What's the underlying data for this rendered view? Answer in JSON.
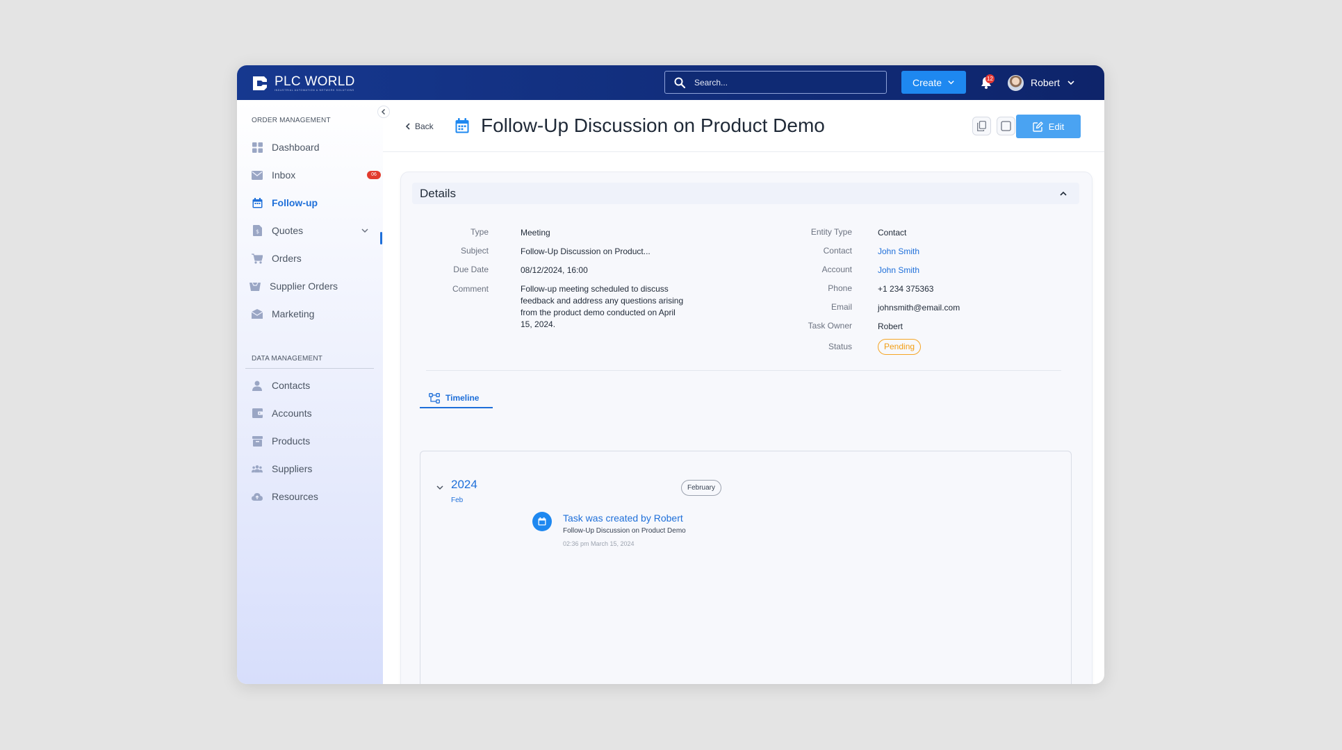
{
  "app": {
    "brand_name": "PLC WORLD",
    "brand_tagline": "INDUSTRIAL AUTOMATION & NETWORK SOLUTIONS",
    "search_placeholder": "Search...",
    "create_label": "Create",
    "notification_count": "12",
    "user_name": "Robert",
    "colors": {
      "topbar": "#16388f",
      "accent": "#1e88f0",
      "link": "#1e6fd9",
      "pending": "#f29d12",
      "badge": "#e23b2e"
    }
  },
  "sidebar": {
    "section_order": "ORDER MANAGEMENT",
    "section_data": "DATA MANAGEMENT",
    "order_items": [
      {
        "label": "Dashboard",
        "icon": "grid-icon"
      },
      {
        "label": "Inbox",
        "icon": "mail-icon",
        "badge": "06"
      },
      {
        "label": "Follow-up",
        "icon": "calendar-icon",
        "active": true
      },
      {
        "label": "Quotes",
        "icon": "quote-icon",
        "expandable": true
      },
      {
        "label": "Orders",
        "icon": "cart-icon"
      },
      {
        "label": "Supplier Orders",
        "icon": "supplier-orders-icon"
      },
      {
        "label": "Marketing",
        "icon": "marketing-icon"
      }
    ],
    "data_items": [
      {
        "label": "Contacts",
        "icon": "person-icon"
      },
      {
        "label": "Accounts",
        "icon": "wallet-icon"
      },
      {
        "label": "Products",
        "icon": "box-icon"
      },
      {
        "label": "Suppliers",
        "icon": "group-icon"
      },
      {
        "label": "Resources",
        "icon": "cloud-icon"
      }
    ]
  },
  "header": {
    "back_label": "Back",
    "title": "Follow-Up Discussion on Product Demo",
    "edit_label": "Edit"
  },
  "details": {
    "section_title": "Details",
    "left_fields": [
      {
        "label": "Type",
        "value": "Meeting"
      },
      {
        "label": "Subject",
        "value": "Follow-Up Discussion on Product..."
      },
      {
        "label": "Due Date",
        "value": "08/12/2024, 16:00"
      },
      {
        "label": "Comment",
        "value": "Follow-up meeting scheduled to discuss feedback and address any questions arising from the product demo conducted on April 15, 2024."
      }
    ],
    "right_fields": [
      {
        "label": "Entity Type",
        "value": "Contact"
      },
      {
        "label": "Contact",
        "value": "John Smith"
      },
      {
        "label": "Account",
        "value": "John Smith"
      },
      {
        "label": "Phone",
        "value": "+1 234 375363"
      },
      {
        "label": "Email",
        "value": "johnsmith@email.com"
      },
      {
        "label": "Task Owner",
        "value": "Robert"
      },
      {
        "label": "Status",
        "value": "Pending"
      }
    ]
  },
  "timeline": {
    "tab_label": "Timeline",
    "year": "2024",
    "month_short": "Feb",
    "month_pill": "February",
    "events": [
      {
        "title": "Task was created by Robert",
        "subtitle": "Follow-Up Discussion on Product Demo",
        "timestamp": "02:36 pm March 15, 2024"
      }
    ]
  }
}
